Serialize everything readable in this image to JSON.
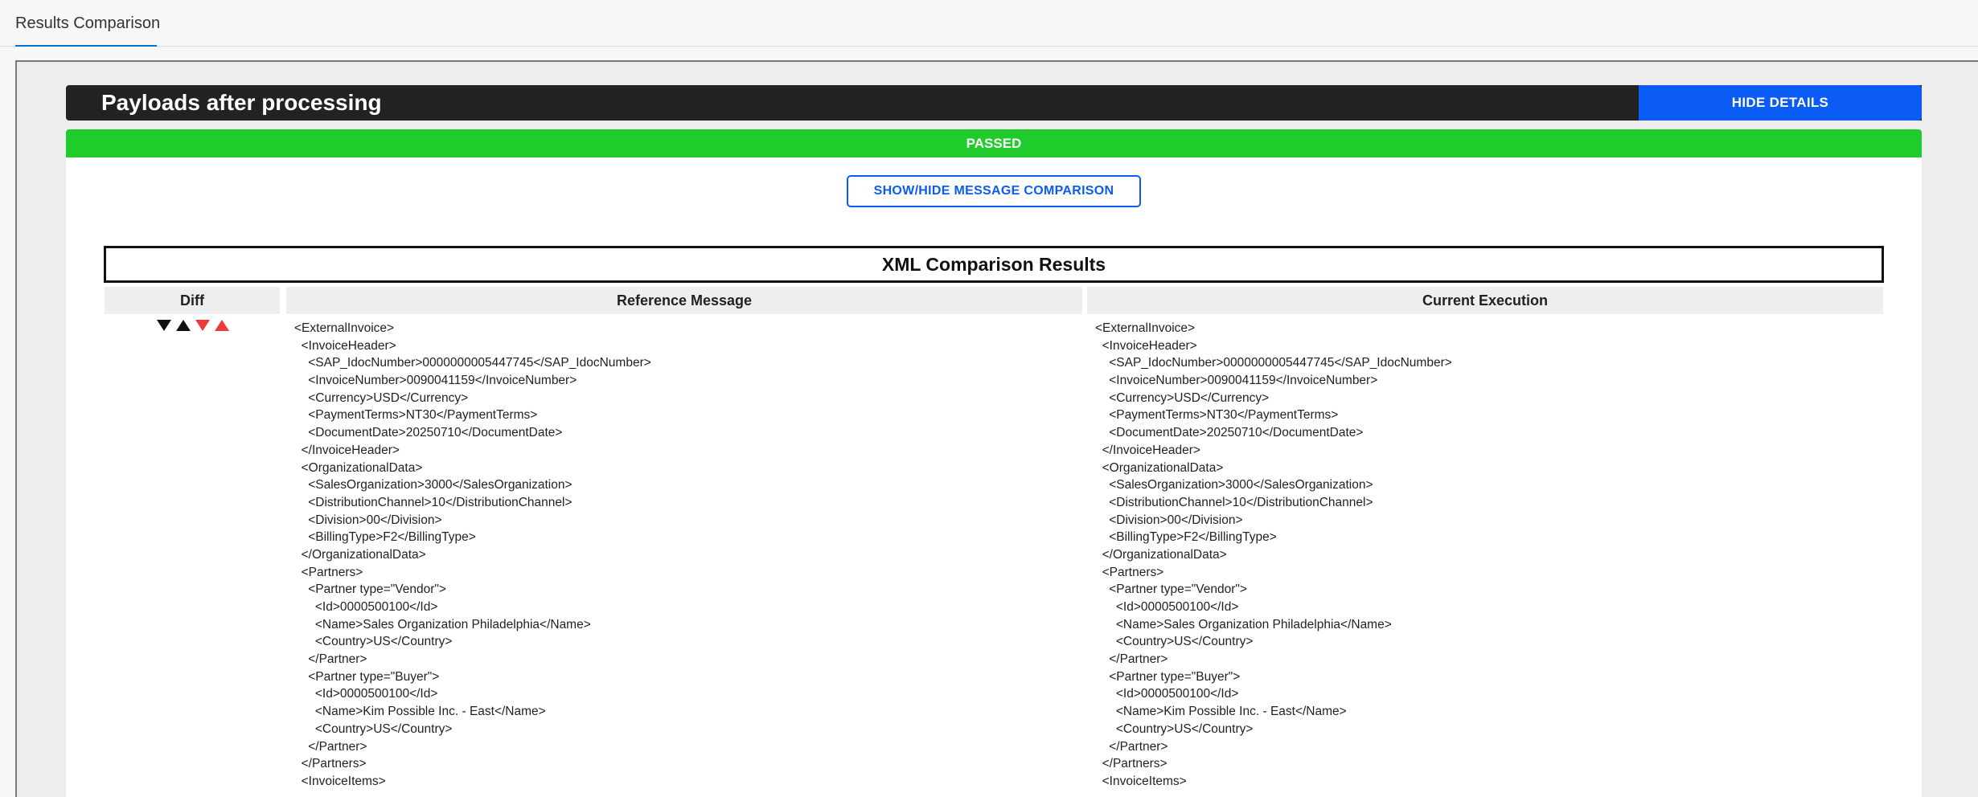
{
  "tab": {
    "label": "Results Comparison"
  },
  "header": {
    "title": "Payloads after processing",
    "hide_details_label": "HIDE DETAILS"
  },
  "status": {
    "label": "PASSED",
    "color": "#1fcc2b"
  },
  "toggle": {
    "label": "SHOW/HIDE MESSAGE COMPARISON"
  },
  "results": {
    "title": "XML Comparison Results",
    "columns": {
      "diff": "Diff",
      "reference": "Reference Message",
      "current": "Current Execution"
    },
    "diff_icons": [
      "triangle-down-black-icon",
      "triangle-up-black-icon",
      "triangle-down-red-icon",
      "triangle-up-red-icon"
    ],
    "reference_lines": [
      "<ExternalInvoice>",
      "  <InvoiceHeader>",
      "    <SAP_IdocNumber>0000000005447745</SAP_IdocNumber>",
      "    <InvoiceNumber>0090041159</InvoiceNumber>",
      "    <Currency>USD</Currency>",
      "    <PaymentTerms>NT30</PaymentTerms>",
      "    <DocumentDate>20250710</DocumentDate>",
      "  </InvoiceHeader>",
      "  <OrganizationalData>",
      "    <SalesOrganization>3000</SalesOrganization>",
      "    <DistributionChannel>10</DistributionChannel>",
      "    <Division>00</Division>",
      "    <BillingType>F2</BillingType>",
      "  </OrganizationalData>",
      "  <Partners>",
      "    <Partner type=\"Vendor\">",
      "      <Id>0000500100</Id>",
      "      <Name>Sales Organization Philadelphia</Name>",
      "      <Country>US</Country>",
      "    </Partner>",
      "    <Partner type=\"Buyer\">",
      "      <Id>0000500100</Id>",
      "      <Name>Kim Possible Inc. - East</Name>",
      "      <Country>US</Country>",
      "    </Partner>",
      "  </Partners>",
      "  <InvoiceItems>"
    ],
    "current_lines": [
      "<ExternalInvoice>",
      "  <InvoiceHeader>",
      "    <SAP_IdocNumber>0000000005447745</SAP_IdocNumber>",
      "    <InvoiceNumber>0090041159</InvoiceNumber>",
      "    <Currency>USD</Currency>",
      "    <PaymentTerms>NT30</PaymentTerms>",
      "    <DocumentDate>20250710</DocumentDate>",
      "  </InvoiceHeader>",
      "  <OrganizationalData>",
      "    <SalesOrganization>3000</SalesOrganization>",
      "    <DistributionChannel>10</DistributionChannel>",
      "    <Division>00</Division>",
      "    <BillingType>F2</BillingType>",
      "  </OrganizationalData>",
      "  <Partners>",
      "    <Partner type=\"Vendor\">",
      "      <Id>0000500100</Id>",
      "      <Name>Sales Organization Philadelphia</Name>",
      "      <Country>US</Country>",
      "    </Partner>",
      "    <Partner type=\"Buyer\">",
      "      <Id>0000500100</Id>",
      "      <Name>Kim Possible Inc. - East</Name>",
      "      <Country>US</Country>",
      "    </Partner>",
      "  </Partners>",
      "  <InvoiceItems>"
    ]
  },
  "colors": {
    "accent": "#0a5cf5",
    "header_bg": "#222222",
    "diff_red": "#f03a3a"
  }
}
